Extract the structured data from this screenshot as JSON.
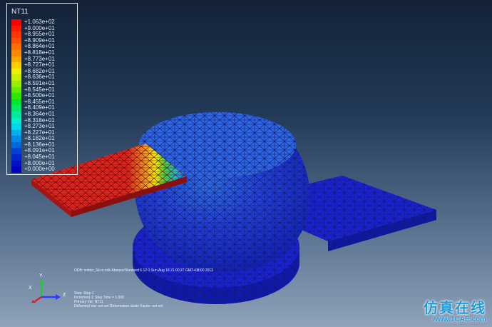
{
  "legend": {
    "title": "NT11",
    "entries": [
      {
        "label": "+1.063e+02",
        "color": "#ff0000"
      },
      {
        "label": "+9.000e+01",
        "color": "#ff1a00"
      },
      {
        "label": "+8.955e+01",
        "color": "#ff3600"
      },
      {
        "label": "+8.909e+01",
        "color": "#ff5200"
      },
      {
        "label": "+8.864e+01",
        "color": "#ff7000"
      },
      {
        "label": "+8.818e+01",
        "color": "#ff8c00"
      },
      {
        "label": "+8.773e+01",
        "color": "#ffaa00"
      },
      {
        "label": "+8.727e+01",
        "color": "#ffd000"
      },
      {
        "label": "+8.682e+01",
        "color": "#f2f200"
      },
      {
        "label": "+8.636e+01",
        "color": "#c8f000"
      },
      {
        "label": "+8.591e+01",
        "color": "#96ee00"
      },
      {
        "label": "+8.545e+01",
        "color": "#64eb00"
      },
      {
        "label": "+8.500e+01",
        "color": "#2ee800"
      },
      {
        "label": "+8.455e+01",
        "color": "#00e62e"
      },
      {
        "label": "+8.409e+01",
        "color": "#00e864"
      },
      {
        "label": "+8.364e+01",
        "color": "#00ea9c"
      },
      {
        "label": "+8.318e+01",
        "color": "#00ecd4"
      },
      {
        "label": "+8.273e+01",
        "color": "#00d6ec"
      },
      {
        "label": "+8.227e+01",
        "color": "#00b0e8"
      },
      {
        "label": "+8.182e+01",
        "color": "#0088e4"
      },
      {
        "label": "+8.136e+01",
        "color": "#0064dc"
      },
      {
        "label": "+8.091e+01",
        "color": "#0042d4"
      },
      {
        "label": "+8.045e+01",
        "color": "#0024cc"
      },
      {
        "label": "+8.000e+01",
        "color": "#0010c4"
      },
      {
        "label": "+0.000e+00",
        "color": "#0000c0"
      }
    ]
  },
  "status": {
    "odb_line": "ODB: solder_3d-m.odb    Abaqus/Standard 6.12-1    Sun Aug 18 21:00:27 GMT+08:00 2013",
    "step_line": "Step: Step-1",
    "increment_line": "Increment     1: Step Time =     1.000",
    "primary_var_line": "Primary Var: NT11",
    "deformed_var_line": "Deformed Var: not set    Deformation Scale Factor: not set"
  },
  "triad": {
    "x": "X",
    "y": "Y",
    "z": "Z"
  },
  "watermark": {
    "cn": "仿真在线",
    "url": "www.1CAE.com"
  },
  "colors": {
    "hot": "#e0231b",
    "cold": "#1a21d8",
    "background_top": "#132237",
    "background_bottom": "#8fa2b9"
  }
}
